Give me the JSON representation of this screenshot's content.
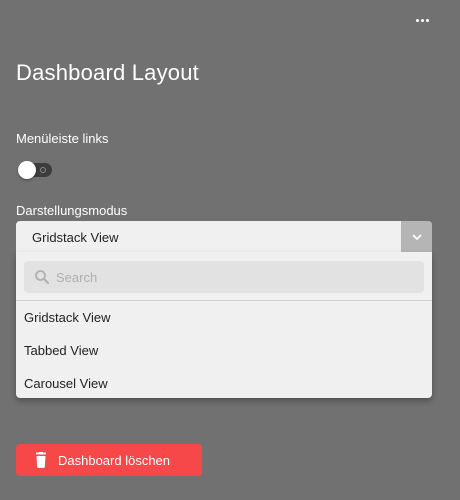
{
  "header": {
    "menu_icon": "more-horizontal-icon"
  },
  "page": {
    "title": "Dashboard Layout"
  },
  "sidebar_setting": {
    "label": "Menüleiste links",
    "enabled": false
  },
  "display_mode": {
    "label": "Darstellungsmodus",
    "selected": "Gridstack View",
    "arrow_icon": "chevron-down-icon",
    "search": {
      "placeholder": "Search",
      "value": "",
      "icon": "search-icon"
    },
    "options": [
      {
        "label": "Gridstack View"
      },
      {
        "label": "Tabbed View"
      },
      {
        "label": "Carousel View"
      }
    ]
  },
  "actions": {
    "delete_label": "Dashboard löschen",
    "delete_icon": "trash-icon",
    "delete_color": "#f74849"
  },
  "colors": {
    "background": "#717171",
    "panel": "#f0f0f0",
    "arrow_button": "#b5b5b5"
  }
}
